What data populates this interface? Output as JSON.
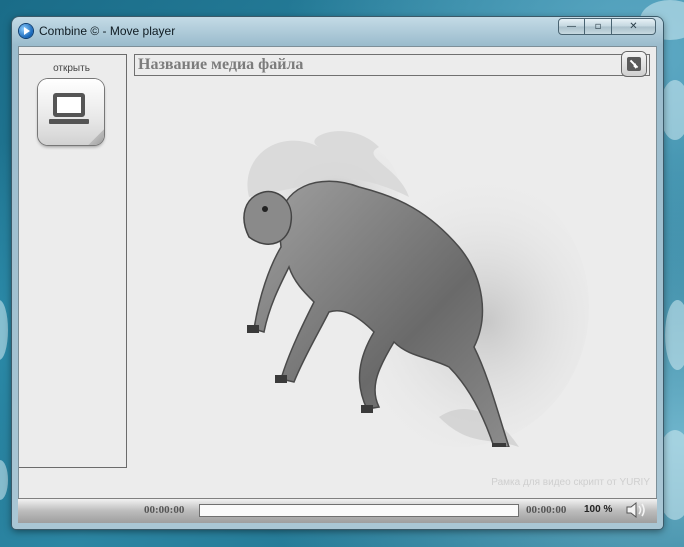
{
  "window": {
    "title": "Combine © - Move player",
    "controls": {
      "minimize": "—",
      "maximize": "▫",
      "close": "✕"
    }
  },
  "sidebar": {
    "open_label": "открыть",
    "open_icon": "computer-icon"
  },
  "media": {
    "title": "Название медиа файла",
    "fullscreen_icon": "fullscreen-icon",
    "artwork": "flaming-horse"
  },
  "watermark": "Рамка для видео скрипт от YURIY",
  "controlbar": {
    "current_time": "00:00:00",
    "total_time": "00:00:00",
    "progress": 0,
    "volume": "100 %",
    "volume_icon": "speaker-icon"
  },
  "colors": {
    "client_bg": "#ececec",
    "desktop": "#1f6f8a",
    "title_text": "#7c7c7c"
  }
}
